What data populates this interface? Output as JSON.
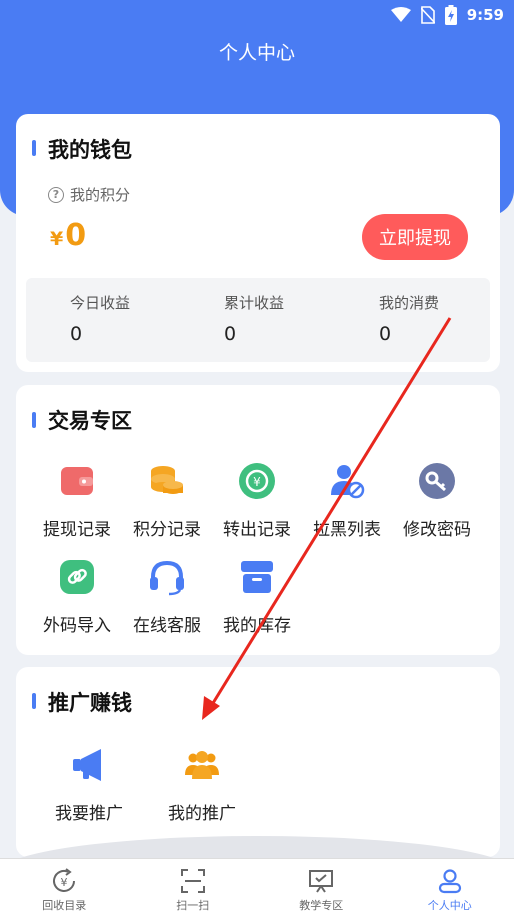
{
  "status_bar": {
    "time": "9:59"
  },
  "header": {
    "title": "个人中心"
  },
  "wallet": {
    "title": "我的钱包",
    "points_label": "我的积分",
    "currency_symbol": "¥",
    "balance": "0",
    "withdraw_button": "立即提现",
    "stats": [
      {
        "label": "今日收益",
        "value": "0"
      },
      {
        "label": "累计收益",
        "value": "0"
      },
      {
        "label": "我的消费",
        "value": "0"
      }
    ]
  },
  "trade": {
    "title": "交易专区",
    "items": [
      {
        "label": "提现记录",
        "icon": "wallet-icon"
      },
      {
        "label": "积分记录",
        "icon": "coins-icon"
      },
      {
        "label": "转出记录",
        "icon": "transfer-icon"
      },
      {
        "label": "拉黑列表",
        "icon": "blocked-user-icon"
      },
      {
        "label": "修改密码",
        "icon": "key-icon"
      },
      {
        "label": "外码导入",
        "icon": "link-icon"
      },
      {
        "label": "在线客服",
        "icon": "headset-icon"
      },
      {
        "label": "我的库存",
        "icon": "inventory-box-icon"
      }
    ]
  },
  "promote": {
    "title": "推广赚钱",
    "items": [
      {
        "label": "我要推广",
        "icon": "megaphone-icon"
      },
      {
        "label": "我的推广",
        "icon": "team-icon"
      }
    ]
  },
  "tabbar": {
    "tabs": [
      {
        "label": "回收目录",
        "icon": "recycle-catalog-icon"
      },
      {
        "label": "扫一扫",
        "icon": "scan-icon"
      },
      {
        "label": "教学专区",
        "icon": "teaching-icon"
      },
      {
        "label": "个人中心",
        "icon": "profile-icon"
      }
    ]
  },
  "colors": {
    "primary": "#4a7cf3",
    "accent_orange": "#f29b12",
    "button_red": "#ff5b5b",
    "arrow_red": "#e8271e"
  }
}
